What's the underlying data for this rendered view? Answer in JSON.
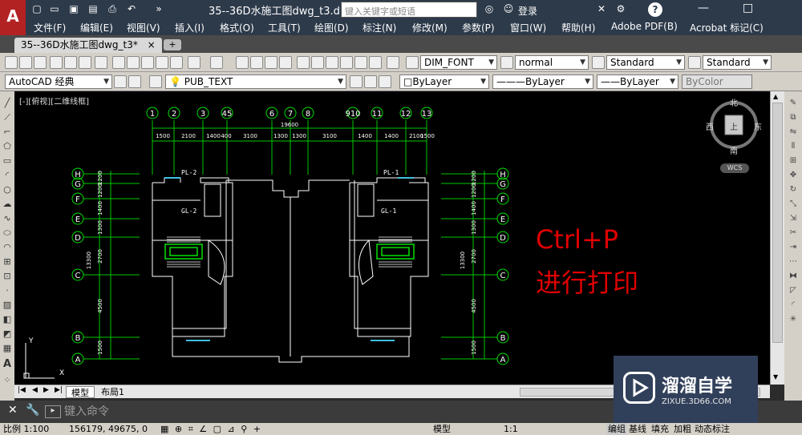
{
  "app": {
    "window_title": "35--36D水施工图dwg_t3.d...",
    "search_placeholder": "键入关键字或短语",
    "login_label": "登录",
    "help_icon": "?",
    "menu": [
      "文件(F)",
      "编辑(E)",
      "视图(V)",
      "插入(I)",
      "格式(O)",
      "工具(T)",
      "绘图(D)",
      "标注(N)",
      "修改(M)",
      "参数(P)",
      "窗口(W)",
      "帮助(H)",
      "Adobe PDF(B)",
      "Acrobat 标记(C)"
    ]
  },
  "tabs": {
    "document_tab": "35--36D水施工图dwg_t3*",
    "close": "×"
  },
  "toolbar": {
    "text_style": "DIM_FONT",
    "dim_style": "normal",
    "table_style": "Standard",
    "multileader_style": "Standard",
    "workspace": "AutoCAD 经典",
    "layer": "PUB_TEXT",
    "color": "ByLayer",
    "linetype": "ByLayer",
    "lineweight": "ByLayer",
    "plotstyle": "ByColor"
  },
  "viewport": {
    "label": "[-][俯视][二维线框]",
    "compass": {
      "north": "北",
      "south": "南",
      "east": "东",
      "west": "西",
      "top_face": "上"
    },
    "wcs": "WCS"
  },
  "drawing": {
    "column_grid": [
      "1",
      "2",
      "3",
      "45",
      "6",
      "7",
      "8",
      "910",
      "11",
      "12",
      "13"
    ],
    "row_grid": [
      "H",
      "G",
      "F",
      "E",
      "D",
      "C",
      "B",
      "A"
    ],
    "overall_dim": "19600",
    "top_dims": [
      "1500",
      "2100",
      "1400",
      "400",
      "3100",
      "1300",
      "1300",
      "3100",
      "1400",
      "1400",
      "2100",
      "1500"
    ],
    "side_dims_left": [
      "1200",
      "1200",
      "1400",
      "1300",
      "2700",
      "4500",
      "1500"
    ],
    "side_total": "13300",
    "labels": [
      "PL-2",
      "GL-2",
      "PL-1",
      "GL-1"
    ]
  },
  "overlay": {
    "line1": "Ctrl+P",
    "line2": "进行打印"
  },
  "layout_tabs": [
    "模型",
    "布局1"
  ],
  "command": {
    "placeholder": "键入命令"
  },
  "status": {
    "scale": "比例 1:100",
    "coords": "156179, 49675, 0",
    "model": "模型",
    "annot_scale": "1:1",
    "buttons": [
      "编组",
      "基线",
      "填充",
      "加粗",
      "动态标注"
    ]
  },
  "watermark": {
    "brand": "溜溜自学",
    "url": "ZIXUE.3D66.COM"
  }
}
